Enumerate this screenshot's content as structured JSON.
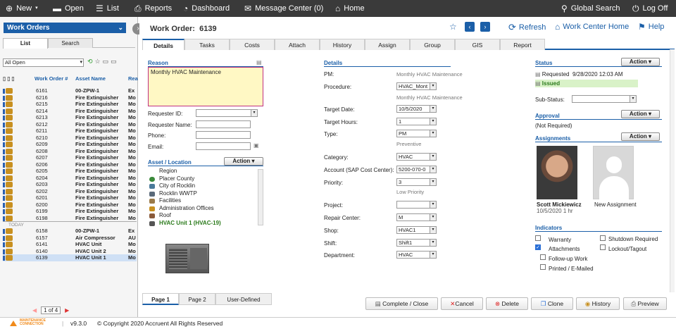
{
  "topbar": {
    "new": "New",
    "open": "Open",
    "list": "List",
    "reports": "Reports",
    "dashboard": "Dashboard",
    "message_center": "Message Center (0)",
    "home": "Home",
    "global_search": "Global Search",
    "logoff": "Log Off"
  },
  "left": {
    "selector": "Work Orders",
    "tabs": [
      "List",
      "Search"
    ],
    "filter": "All Open",
    "headers": {
      "wo": "Work Order #",
      "asset": "Asset Name",
      "rea": "Rea"
    },
    "rows": [
      {
        "wo": "6161",
        "asset": "00-ZPW-1",
        "rea": "Ex"
      },
      {
        "wo": "6216",
        "asset": "Fire Extinguisher",
        "rea": "Mo"
      },
      {
        "wo": "6215",
        "asset": "Fire Extinguisher",
        "rea": "Mo"
      },
      {
        "wo": "6214",
        "asset": "Fire Extinguisher",
        "rea": "Mo"
      },
      {
        "wo": "6213",
        "asset": "Fire Extinguisher",
        "rea": "Mo"
      },
      {
        "wo": "6212",
        "asset": "Fire Extinguisher",
        "rea": "Mo"
      },
      {
        "wo": "6211",
        "asset": "Fire Extinguisher",
        "rea": "Mo"
      },
      {
        "wo": "6210",
        "asset": "Fire Extinguisher",
        "rea": "Mo"
      },
      {
        "wo": "6209",
        "asset": "Fire Extinguisher",
        "rea": "Mo"
      },
      {
        "wo": "6208",
        "asset": "Fire Extinguisher",
        "rea": "Mo"
      },
      {
        "wo": "6207",
        "asset": "Fire Extinguisher",
        "rea": "Mo"
      },
      {
        "wo": "6206",
        "asset": "Fire Extinguisher",
        "rea": "Mo"
      },
      {
        "wo": "6205",
        "asset": "Fire Extinguisher",
        "rea": "Mo"
      },
      {
        "wo": "6204",
        "asset": "Fire Extinguisher",
        "rea": "Mo"
      },
      {
        "wo": "6203",
        "asset": "Fire Extinguisher",
        "rea": "Mo"
      },
      {
        "wo": "6202",
        "asset": "Fire Extinguisher",
        "rea": "Mo"
      },
      {
        "wo": "6201",
        "asset": "Fire Extinguisher",
        "rea": "Mo"
      },
      {
        "wo": "6200",
        "asset": "Fire Extinguisher",
        "rea": "Mo"
      },
      {
        "wo": "6199",
        "asset": "Fire Extinguisher",
        "rea": "Mo"
      },
      {
        "wo": "6198",
        "asset": "Fire Extinguisher",
        "rea": "Mo"
      }
    ],
    "today_label": "TODAY",
    "today_rows": [
      {
        "wo": "6158",
        "asset": "00-ZPW-1",
        "rea": "Ex"
      },
      {
        "wo": "6157",
        "asset": "Air Compressor",
        "rea": "AU"
      },
      {
        "wo": "6141",
        "asset": "HVAC Unit",
        "rea": "Mo"
      },
      {
        "wo": "6140",
        "asset": "HVAC Unit 2",
        "rea": "Mo"
      },
      {
        "wo": "6139",
        "asset": "HVAC Unit 1",
        "rea": "Mo"
      }
    ],
    "pager": "1 of 4"
  },
  "footer": {
    "brand_line1": "MAINTENANCE",
    "brand_line2": "CONNECTION",
    "version": "v9.3.0",
    "copyright": "© Copyright 2020 Accruent All Rights Reserved"
  },
  "main": {
    "title_label": "Work Order:",
    "title_value": "6139",
    "refresh": "Refresh",
    "wch": "Work Center Home",
    "help": "Help",
    "tabs": [
      "Details",
      "Tasks",
      "Costs",
      "Attach",
      "History",
      "Assign",
      "Group",
      "GIS",
      "Report"
    ],
    "reason": {
      "label": "Reason",
      "value": "Monthly HVAC Maintenance"
    },
    "requester": {
      "id_label": "Requester ID:",
      "name_label": "Requester Name:",
      "phone_label": "Phone:",
      "email_label": "Email:"
    },
    "asset_location": {
      "label": "Asset / Location",
      "action": "Action",
      "items": [
        "Region",
        "Placer County",
        "City of Rocklin",
        "Rocklin WWTP",
        "Facilities",
        "Administration Offices",
        "Roof",
        "HVAC Unit 1 (HVAC-19)"
      ]
    },
    "details": {
      "label": "Details",
      "pm_label": "PM:",
      "pm_value": "Monthly HVAC Maintenance",
      "procedure_label": "Procedure:",
      "procedure_value": "HVAC_Mont",
      "procedure_sub": "Monthly HVAC Maintenance",
      "target_date_label": "Target Date:",
      "target_date_value": "10/5/2020",
      "target_hours_label": "Target Hours:",
      "target_hours_value": "1",
      "type_label": "Type:",
      "type_value": "PM",
      "type_sub": "Preventive",
      "category_label": "Category:",
      "category_value": "HVAC",
      "account_label": "Account (SAP Cost Center):",
      "account_value": "5200-070-0",
      "priority_label": "Priority:",
      "priority_value": "3",
      "priority_sub": "Low Priority",
      "project_label": "Project:",
      "project_value": "",
      "repair_center_label": "Repair Center:",
      "repair_center_value": "M",
      "shop_label": "Shop:",
      "shop_value": "HVAC1",
      "shift_label": "Shift:",
      "shift_value": "Shift1",
      "department_label": "Department:",
      "department_value": "HVAC"
    },
    "status": {
      "label": "Status",
      "action": "Action",
      "requested_label": "Requested",
      "requested_value": "9/28/2020 12:03 AM",
      "issued": "Issued",
      "substatus_label": "Sub-Status:"
    },
    "approval": {
      "label": "Approval",
      "action": "Action",
      "value": "(Not Required)"
    },
    "assignments": {
      "label": "Assignments",
      "action": "Action",
      "person_name": "Scott Mickiewicz",
      "person_sub": "10/5/2020 1 hr",
      "new_label": "New Assignment"
    },
    "indicators": {
      "label": "Indicators",
      "warranty": "Warranty",
      "shutdown": "Shutdown Required",
      "attachments": "Attachments",
      "lockout": "Lockout/Tagout",
      "followup": "Follow-up Work",
      "printed": "Printed / E-Mailed"
    },
    "page_tabs": [
      "Page 1",
      "Page 2",
      "User-Defined"
    ],
    "buttons": {
      "complete": "Complete / Close",
      "cancel": "Cancel",
      "delete": "Delete",
      "clone": "Clone",
      "history": "History",
      "preview": "Preview"
    }
  },
  "colors": {
    "accent": "#1b5fa8",
    "topbar": "#3a3a3a",
    "reason_bg": "#fff8c4",
    "issued_bg": "#d9f2c8",
    "issued_text": "#2a7a1a"
  }
}
